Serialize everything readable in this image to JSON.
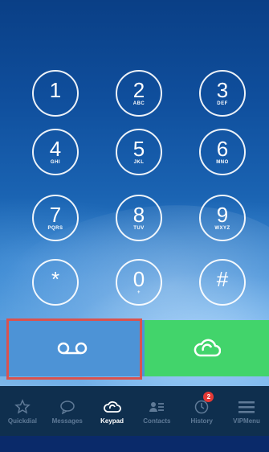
{
  "keypad": {
    "keys": [
      {
        "digit": "1",
        "letters": ""
      },
      {
        "digit": "2",
        "letters": "ABC"
      },
      {
        "digit": "3",
        "letters": "DEF"
      },
      {
        "digit": "4",
        "letters": "GHI"
      },
      {
        "digit": "5",
        "letters": "JKL"
      },
      {
        "digit": "6",
        "letters": "MNO"
      },
      {
        "digit": "7",
        "letters": "PQRS"
      },
      {
        "digit": "8",
        "letters": "TUV"
      },
      {
        "digit": "9",
        "letters": "WXYZ"
      },
      {
        "digit": "*",
        "letters": ""
      },
      {
        "digit": "0",
        "letters": "+"
      },
      {
        "digit": "#",
        "letters": ""
      }
    ]
  },
  "actions": {
    "voicemail_icon": "voicemail-icon",
    "call_icon": "cloud-call-icon",
    "voicemail_color": "#4d93d6",
    "call_color": "#42d46b",
    "highlight_color": "#d9534f"
  },
  "nav": {
    "items": [
      {
        "label": "Quickdial",
        "icon": "star-icon"
      },
      {
        "label": "Messages",
        "icon": "chat-bubble-icon"
      },
      {
        "label": "Keypad",
        "icon": "cloud-logo-icon",
        "active": true
      },
      {
        "label": "Contacts",
        "icon": "contacts-icon"
      },
      {
        "label": "History",
        "icon": "clock-icon",
        "badge": "2"
      },
      {
        "label": "VIPMenu",
        "icon": "menu-icon"
      }
    ]
  }
}
